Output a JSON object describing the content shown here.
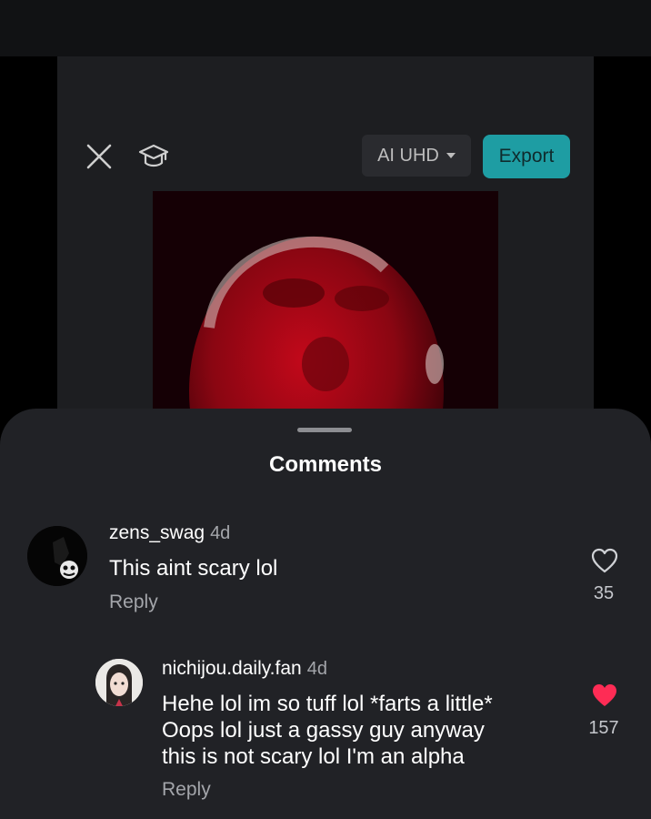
{
  "editor": {
    "quality_label": "AI UHD",
    "export_label": "Export"
  },
  "comments_sheet": {
    "title": "Comments",
    "comments": [
      {
        "username": "zens_swag",
        "time": "4d",
        "text": "This aint scary lol",
        "reply_label": "Reply",
        "like_count": "35",
        "liked": false
      },
      {
        "username": "nichijou.daily.fan",
        "time": "4d",
        "text_lines": [
          "Hehe lol im so tuff lol *farts a little*",
          "Oops lol just a gassy guy anyway",
          "this is not scary lol I'm an alpha"
        ],
        "reply_label": "Reply",
        "like_count": "157",
        "liked": true
      }
    ]
  },
  "colors": {
    "accent": "#1e9da3",
    "like_active": "#fe2c55",
    "sheet_bg": "#212226",
    "secondary_text": "#a4a6ab"
  },
  "icons": [
    "close-icon",
    "graduation-cap-icon",
    "caret-down-icon",
    "heart-outline-icon",
    "heart-filled-icon"
  ]
}
